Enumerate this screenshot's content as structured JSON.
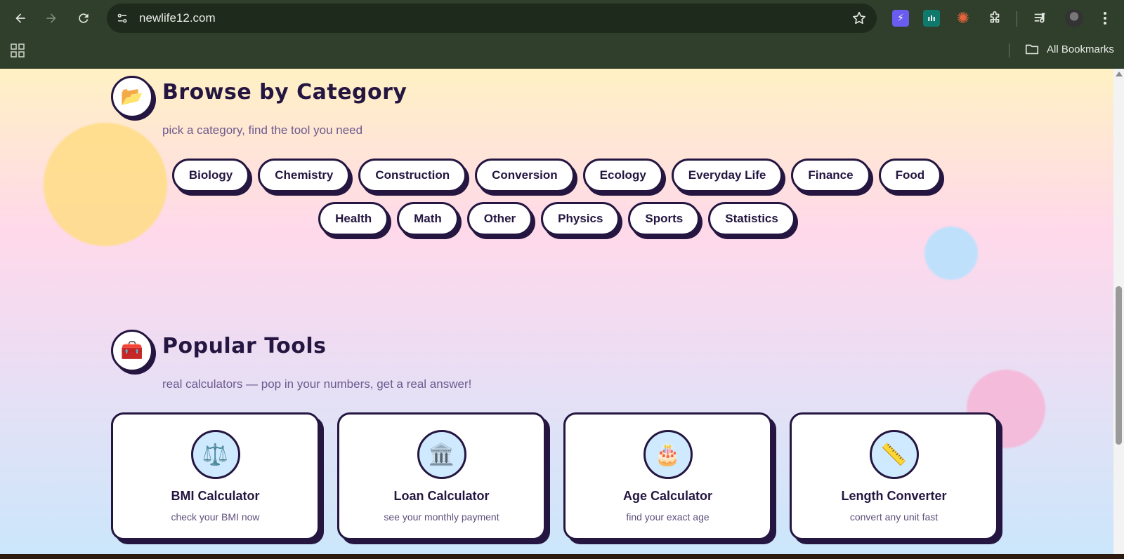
{
  "browser": {
    "url": "newlife12.com",
    "bookmarks_label": "All Bookmarks",
    "extensions": [
      {
        "name": "bolt-extension-icon",
        "color": "#6b5cf0",
        "glyph": "⚡"
      },
      {
        "name": "chart-extension-icon",
        "color": "#0f7a6c",
        "glyph": "ılı"
      },
      {
        "name": "sparkle-extension-icon",
        "color": "#e8643c",
        "glyph": "✺"
      }
    ]
  },
  "category_section": {
    "icon": "📂",
    "title": "Browse by Category",
    "subtitle": "pick a category, find the tool you need",
    "row1": [
      "Biology",
      "Chemistry",
      "Construction",
      "Conversion",
      "Ecology",
      "Everyday Life",
      "Finance",
      "Food"
    ],
    "row2": [
      "Health",
      "Math",
      "Other",
      "Physics",
      "Sports",
      "Statistics"
    ]
  },
  "tools_section": {
    "icon": "🧰",
    "title": "Popular Tools",
    "subtitle": "real calculators — pop in your numbers, get a real answer!",
    "cards": [
      {
        "icon": "⚖️",
        "title": "BMI Calculator",
        "desc": "check your BMI now"
      },
      {
        "icon": "🏛️",
        "title": "Loan Calculator",
        "desc": "see your monthly payment"
      },
      {
        "icon": "🎂",
        "title": "Age Calculator",
        "desc": "find your exact age"
      },
      {
        "icon": "📏",
        "title": "Length Converter",
        "desc": "convert any unit fast"
      }
    ]
  },
  "colors": {
    "ink": "#241640",
    "chrome": "#2f3f2c",
    "omnibox": "#1e2a1c",
    "card_icon_bg": "#cfeaff"
  }
}
